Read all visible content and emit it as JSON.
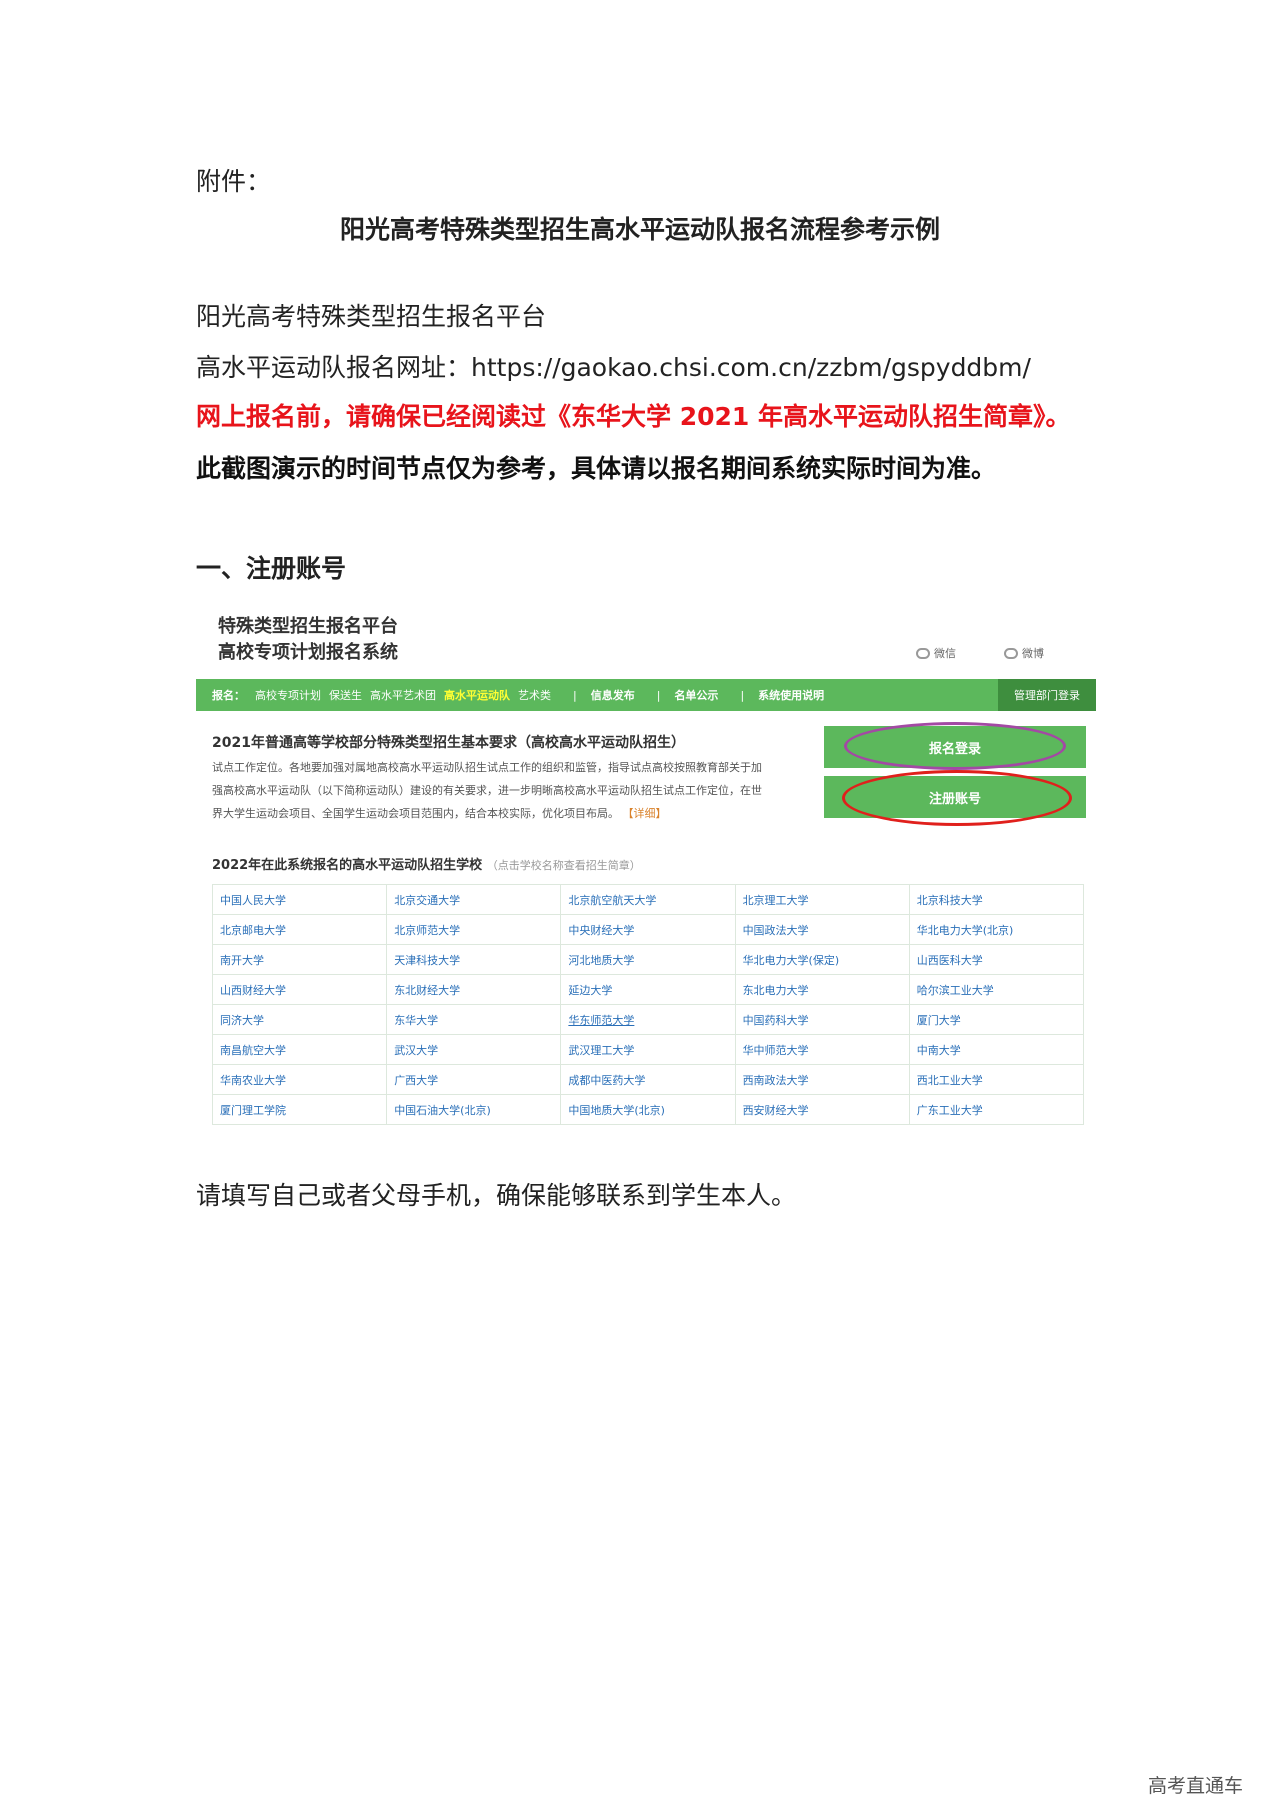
{
  "doc": {
    "attachment": "附件：",
    "title": "阳光高考特殊类型招生高水平运动队报名流程参考示例",
    "platform": "阳光高考特殊类型招生报名平台",
    "url_line": "高水平运动队报名网址：https://gaokao.chsi.com.cn/zzbm/gspyddbm/",
    "notice_red": "网上报名前，请确保已经阅读过《东华大学 2021 年高水平运动队招生简章》。",
    "notice_bold": "此截图演示的时间节点仅为参考，具体请以报名期间系统实际时间为准。",
    "section1": "一、注册账号",
    "phone_note": "请填写自己或者父母手机，确保能够联系到学生本人。",
    "footer_mark": "高考直通车"
  },
  "screenshot": {
    "site_title_1": "特殊类型招生报名平台",
    "site_title_2": "高校专项计划报名系统",
    "wechat": "微信",
    "weibo": "微博",
    "nav": {
      "label": "报名：",
      "items": [
        "高校专项计划",
        "保送生",
        "高水平艺术团",
        "高水平运动队",
        "艺术类"
      ],
      "sep": "|",
      "info": "信息发布",
      "publicity": "名单公示",
      "guide": "系统使用说明",
      "admin": "管理部门登录"
    },
    "req_title": "2021年普通高等学校部分特殊类型招生基本要求（高校高水平运动队招生）",
    "req_body": "试点工作定位。各地要加强对属地高校高水平运动队招生试点工作的组织和监管，指导试点高校按照教育部关于加强高校高水平运动队（以下简称运动队）建设的有关要求，进一步明晰高校高水平运动队招生试点工作定位，在世界大学生运动会项目、全国学生运动会项目范围内，结合本校实际，优化项目布局。",
    "req_more": "【详细】",
    "login_button": "报名登录",
    "register_button": "注册账号",
    "schools_title": "2022年在此系统报名的高水平运动队招生学校",
    "schools_hint": "（点击学校名称查看招生简章）",
    "schools": [
      [
        "中国人民大学",
        "北京交通大学",
        "北京航空航天大学",
        "北京理工大学",
        "北京科技大学"
      ],
      [
        "北京邮电大学",
        "北京师范大学",
        "中央财经大学",
        "中国政法大学",
        "华北电力大学(北京)"
      ],
      [
        "南开大学",
        "天津科技大学",
        "河北地质大学",
        "华北电力大学(保定)",
        "山西医科大学"
      ],
      [
        "山西财经大学",
        "东北财经大学",
        "延边大学",
        "东北电力大学",
        "哈尔滨工业大学"
      ],
      [
        "同济大学",
        "东华大学",
        "华东师范大学",
        "中国药科大学",
        "厦门大学"
      ],
      [
        "南昌航空大学",
        "武汉大学",
        "武汉理工大学",
        "华中师范大学",
        "中南大学"
      ],
      [
        "华南农业大学",
        "广西大学",
        "成都中医药大学",
        "西南政法大学",
        "西北工业大学"
      ],
      [
        "厦门理工学院",
        "中国石油大学(北京)",
        "中国地质大学(北京)",
        "西安财经大学",
        "广东工业大学"
      ]
    ]
  }
}
